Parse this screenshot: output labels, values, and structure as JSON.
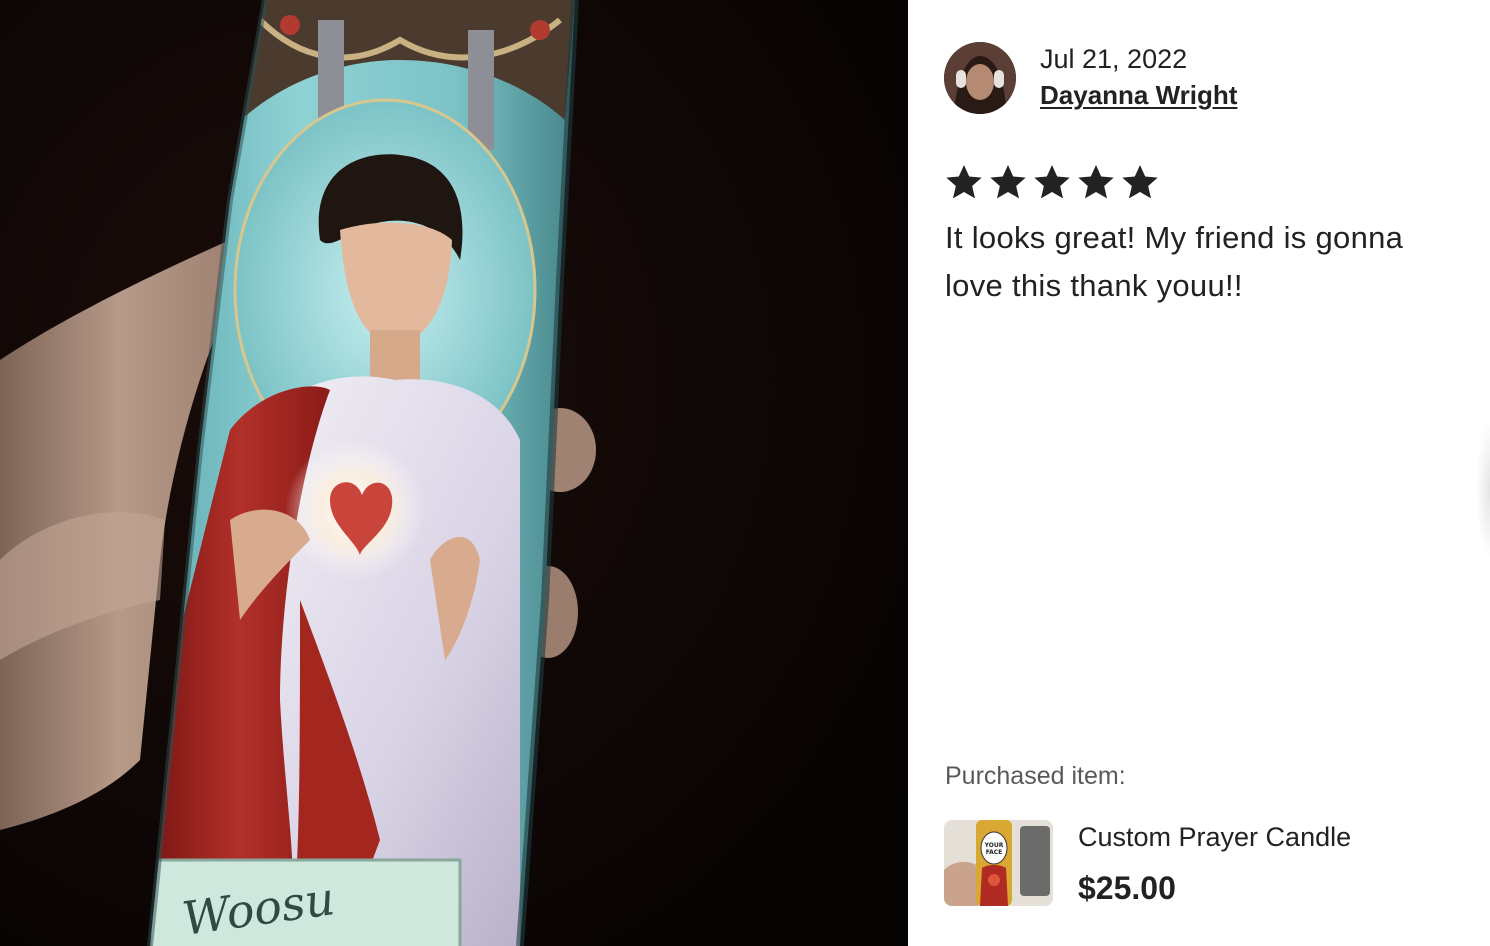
{
  "review": {
    "date": "Jul 21, 2022",
    "reviewer_name": "Dayanna Wright",
    "rating": 5,
    "rating_max": 5,
    "text": "It looks great! My friend is gonna love this thank youu!!"
  },
  "purchase": {
    "label": "Purchased item:",
    "product_name": "Custom Prayer Candle",
    "price": "$25.00",
    "thumb_text": "YOUR FACE"
  },
  "photo": {
    "candle_label_text": "Woosu"
  },
  "icons": {
    "star": "star-icon",
    "avatar": "avatar",
    "thumb": "product-thumbnail"
  },
  "colors": {
    "text": "#222222",
    "muted": "#595959",
    "star": "#222222",
    "photo_background": "#0a0505",
    "candle_blue": "#7cc3c6",
    "robe_red": "#a8231f"
  }
}
